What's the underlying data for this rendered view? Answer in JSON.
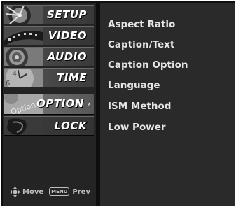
{
  "sidebar": {
    "items": [
      {
        "label": "SETUP",
        "icon": "setup-thumbnail-icon"
      },
      {
        "label": "VIDEO",
        "icon": "video-thumbnail-icon"
      },
      {
        "label": "AUDIO",
        "icon": "audio-thumbnail-icon"
      },
      {
        "label": "TIME",
        "icon": "clock-thumbnail-icon"
      },
      {
        "label": "OPTION",
        "icon": "option-thumbnail-icon",
        "thumb_text": "Option",
        "selected": true,
        "arrow": "›"
      },
      {
        "label": "LOCK",
        "icon": "lock-thumbnail-icon"
      }
    ]
  },
  "submenu": {
    "items": [
      {
        "label": "Aspect Ratio"
      },
      {
        "label": "Caption/Text"
      },
      {
        "label": "Caption Option"
      },
      {
        "label": "Language"
      },
      {
        "label": "ISM Method"
      },
      {
        "label": "Low Power"
      }
    ]
  },
  "nav_hint": {
    "move_icon": "move-dpad-icon",
    "move_label": "Move",
    "menu_key": "MENU",
    "prev_label": "Prev"
  },
  "colors": {
    "background": "#0e0e0e",
    "sidebar": "#242424",
    "submenu": "#2a2a2a",
    "text": "#e6e6e6"
  }
}
